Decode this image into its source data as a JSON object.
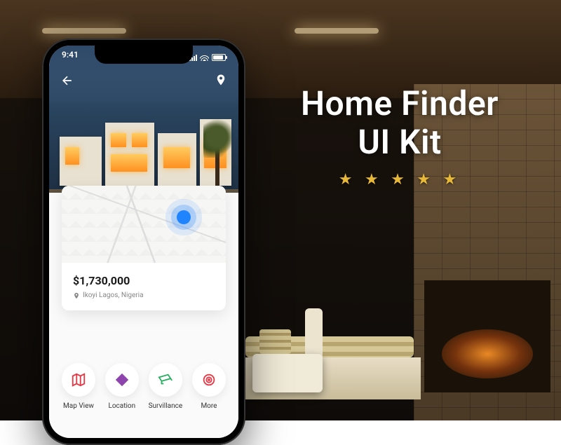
{
  "promo": {
    "title_line1": "Home Finder",
    "title_line2": "UI Kit",
    "stars": "★ ★ ★ ★ ★"
  },
  "phone": {
    "status": {
      "time": "9:41"
    },
    "listing": {
      "price": "$1,730,000",
      "location": "Ikoyi Lagos, Nigeria"
    },
    "features": [
      {
        "label": "Map View",
        "icon": "map-icon",
        "color": "#e63946"
      },
      {
        "label": "Location",
        "icon": "directions-icon",
        "color": "#8e44ad"
      },
      {
        "label": "Survillance",
        "icon": "camera-icon",
        "color": "#27ae60"
      },
      {
        "label": "More",
        "icon": "target-icon",
        "color": "#e63946"
      }
    ]
  }
}
